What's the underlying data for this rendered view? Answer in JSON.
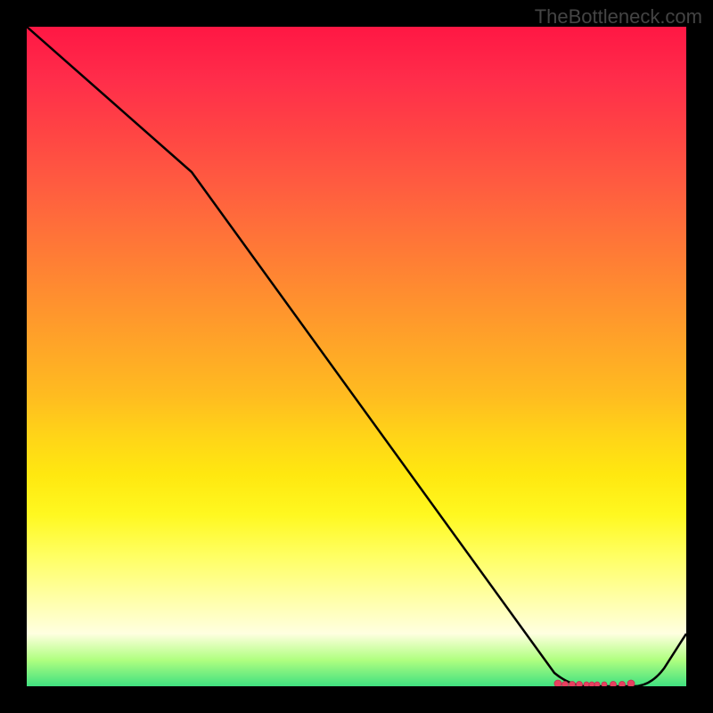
{
  "watermark": "TheBottleneck.com",
  "chart_data": {
    "type": "line",
    "title": "",
    "xlabel": "",
    "ylabel": "",
    "xlim": [
      0,
      100
    ],
    "ylim": [
      0,
      100
    ],
    "series": [
      {
        "name": "curve",
        "x": [
          0,
          25,
          80,
          85,
          92,
          100
        ],
        "y": [
          100,
          78,
          2,
          0,
          0,
          8
        ]
      }
    ],
    "markers": {
      "x_range": [
        80,
        92
      ],
      "y": 0,
      "color": "#ff4060",
      "description": "cluster of red dots along bottom where curve reaches minimum"
    },
    "gradient": {
      "top": "#ff1744",
      "middle": "#ffd418",
      "bottom": "#40e080"
    }
  }
}
